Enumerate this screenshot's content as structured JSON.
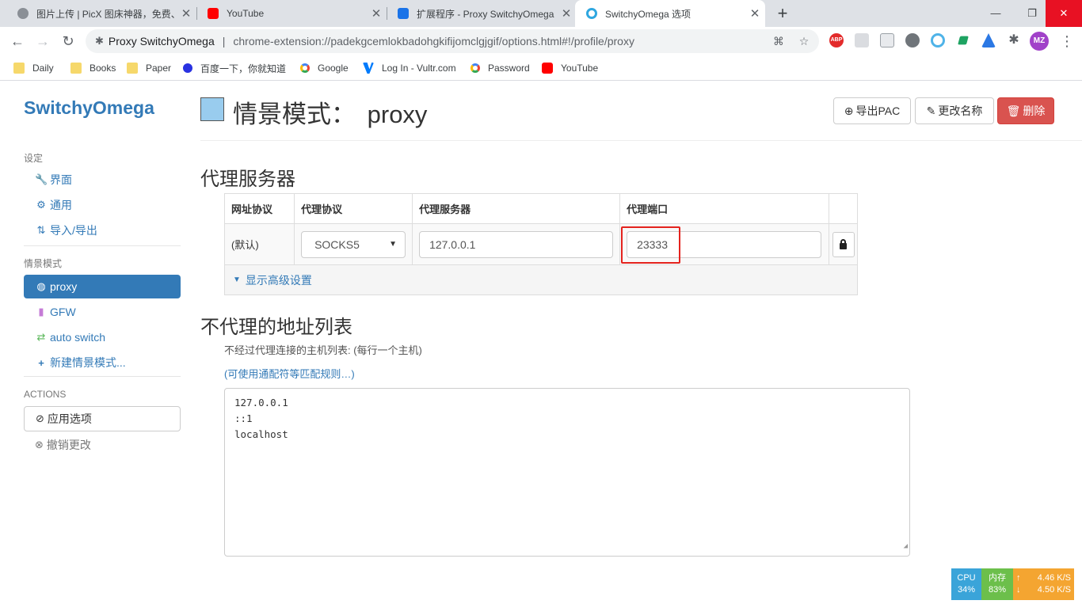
{
  "browser": {
    "tabs": [
      {
        "title": "图片上传 | PicX 图床神器，免费、",
        "favicon_color": "#8a8f96",
        "active": false
      },
      {
        "title": "YouTube",
        "favicon_color": "#ff0000",
        "active": false
      },
      {
        "title": "扩展程序 - Proxy SwitchyOmega",
        "favicon_color": "#1a73e8",
        "active": false
      },
      {
        "title": "SwitchyOmega 选项",
        "favicon_color": "#2fa7e0",
        "active": true
      }
    ],
    "new_tab": "+",
    "window_controls": {
      "minimize": "—",
      "restore": "❐",
      "close": "✕"
    },
    "omnibox": {
      "site_name": "Proxy SwitchyOmega",
      "separator": "|",
      "url": "chrome-extension://padekgcemlokbadohgkifijomclgjgif/options.html#!/profile/proxy"
    },
    "extensions": {
      "abp": "ABP"
    },
    "avatar_initials": "MZ",
    "bookmarks": [
      {
        "label": "Daily",
        "icon": "folder-icon"
      },
      {
        "label": "Books",
        "icon": "folder-icon"
      },
      {
        "label": "Paper",
        "icon": "folder-icon"
      },
      {
        "label": "百度一下，你就知道",
        "icon": "baidu-icon"
      },
      {
        "label": "Google",
        "icon": "google-icon"
      },
      {
        "label": "Log In - Vultr.com",
        "icon": "vultr-icon"
      },
      {
        "label": "Password",
        "icon": "google-icon"
      },
      {
        "label": "YouTube",
        "icon": "youtube-icon"
      }
    ]
  },
  "app": {
    "brand": "SwitchyOmega",
    "sidebar": {
      "settings_header": "设定",
      "settings_items": [
        {
          "label": "界面",
          "icon": "wrench-icon"
        },
        {
          "label": "通用",
          "icon": "gear-icon"
        },
        {
          "label": "导入/导出",
          "icon": "import-export-icon"
        }
      ],
      "profiles_header": "情景模式",
      "profile_items": [
        {
          "label": "proxy",
          "icon": "globe-icon",
          "active": true
        },
        {
          "label": "GFW",
          "icon": "file-icon"
        },
        {
          "label": "auto switch",
          "icon": "retweet-icon"
        },
        {
          "label": "新建情景模式...",
          "icon": "plus-icon"
        }
      ],
      "actions_header": "ACTIONS",
      "apply_label": "应用选项",
      "discard_label": "撤销更改"
    },
    "header": {
      "title_prefix": "情景模式：",
      "profile_name": "proxy",
      "profile_color": "#99ccee",
      "export_pac": "导出PAC",
      "rename": "更改名称",
      "delete": "删除"
    },
    "proxy_servers": {
      "title": "代理服务器",
      "columns": [
        "网址协议",
        "代理协议",
        "代理服务器",
        "代理端口"
      ],
      "row": {
        "scheme": "(默认)",
        "protocol": "SOCKS5",
        "server": "127.0.0.1",
        "port": "23333"
      },
      "advanced_label": "显示高级设置"
    },
    "bypass": {
      "title": "不代理的地址列表",
      "help": "不经过代理连接的主机列表: (每行一个主机)",
      "link": "(可使用通配符等匹配规则…)",
      "list": "127.0.0.1\n::1\nlocalhost"
    }
  },
  "system_monitor": {
    "cpu_label": "CPU",
    "cpu_value": "34%",
    "mem_label": "内存",
    "mem_value": "83%",
    "up_speed": "4.46 K/S",
    "down_speed": "4.50 K/S",
    "colors": {
      "cpu": "#3aa4d9",
      "mem": "#6cbf4b",
      "net": "#f4a531"
    }
  }
}
